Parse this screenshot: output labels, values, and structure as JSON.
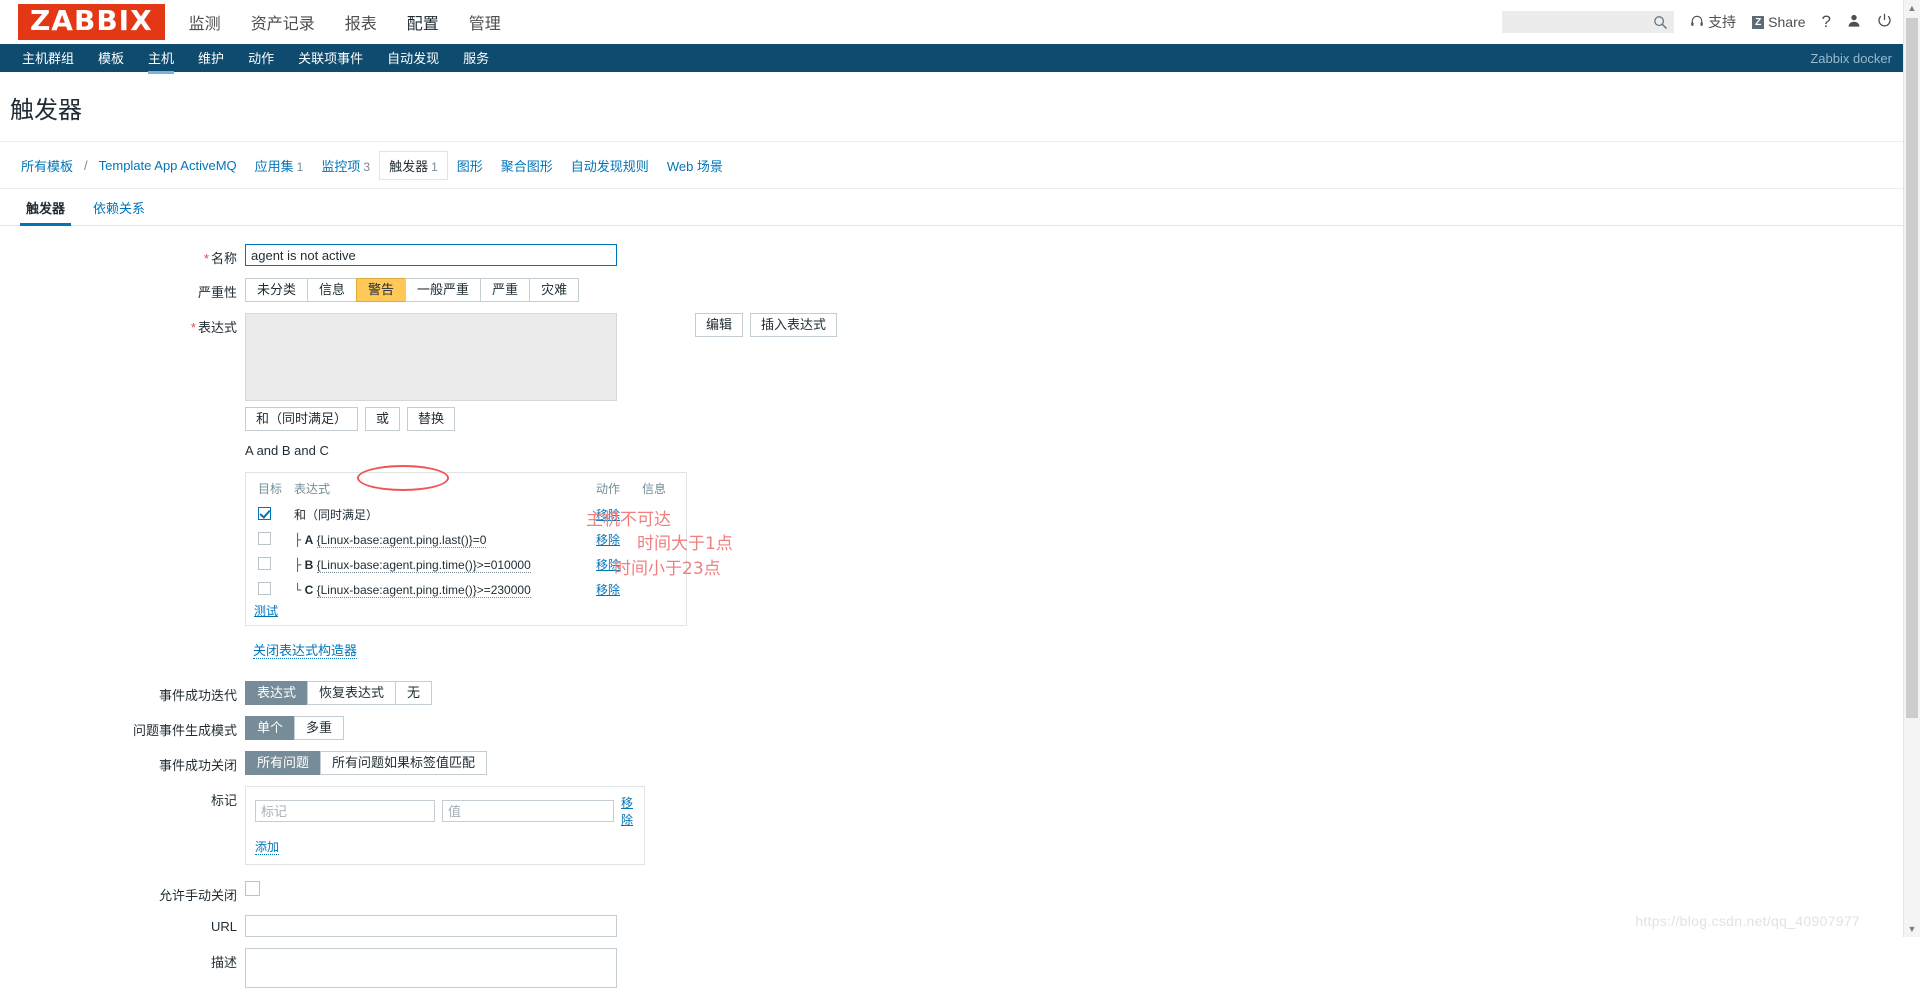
{
  "header": {
    "logo": "ZABBIX",
    "nav": [
      {
        "label": "监测",
        "active": false
      },
      {
        "label": "资产记录",
        "active": false
      },
      {
        "label": "报表",
        "active": false
      },
      {
        "label": "配置",
        "active": true
      },
      {
        "label": "管理",
        "active": false
      }
    ],
    "search_placeholder": "",
    "search_value": "",
    "support_label": "支持",
    "share_label": "Share",
    "share_badge": "Z",
    "help_label": "?",
    "icons": {
      "search": "search-icon",
      "support": "headset-icon",
      "share": "share-icon",
      "help": "question-mark-icon",
      "user": "user-icon",
      "power": "power-icon"
    }
  },
  "subnav": {
    "items": [
      {
        "label": "主机群组",
        "active": false
      },
      {
        "label": "模板",
        "active": false
      },
      {
        "label": "主机",
        "active": true
      },
      {
        "label": "维护",
        "active": false
      },
      {
        "label": "动作",
        "active": false
      },
      {
        "label": "关联项事件",
        "active": false
      },
      {
        "label": "自动发现",
        "active": false
      },
      {
        "label": "服务",
        "active": false
      }
    ],
    "server_name": "Zabbix docker"
  },
  "page": {
    "title": "触发器"
  },
  "breadcrumb": {
    "all_templates": "所有模板",
    "separator": "/",
    "template_name": "Template App ActiveMQ",
    "items": [
      {
        "label": "应用集",
        "count": "1",
        "active": false
      },
      {
        "label": "监控项",
        "count": "3",
        "active": false
      },
      {
        "label": "触发器",
        "count": "1",
        "active": true
      },
      {
        "label": "图形",
        "count": "",
        "active": false
      },
      {
        "label": "聚合图形",
        "count": "",
        "active": false
      },
      {
        "label": "自动发现规则",
        "count": "",
        "active": false
      },
      {
        "label": "Web 场景",
        "count": "",
        "active": false
      }
    ]
  },
  "form_tabs": [
    {
      "label": "触发器",
      "active": true
    },
    {
      "label": "依赖关系",
      "active": false
    }
  ],
  "form": {
    "name_label": "名称",
    "name_value": "agent is not active",
    "severity_label": "严重性",
    "severity_options": [
      {
        "label": "未分类",
        "selected": false
      },
      {
        "label": "信息",
        "selected": false
      },
      {
        "label": "警告",
        "selected": true
      },
      {
        "label": "一般严重",
        "selected": false
      },
      {
        "label": "严重",
        "selected": false
      },
      {
        "label": "灾难",
        "selected": false
      }
    ],
    "expression_label": "表达式",
    "expression_value": "",
    "edit_button": "编辑",
    "insert_expression_button": "插入表达式",
    "op_and": "和（同时满足）",
    "op_or": "或",
    "op_replace": "替换",
    "expression_preview": "A and B and C",
    "close_constructor_link": "关闭表达式构造器",
    "event_success_label": "事件成功迭代",
    "event_success_options": [
      {
        "label": "表达式",
        "selected": true
      },
      {
        "label": "恢复表达式",
        "selected": false
      },
      {
        "label": "无",
        "selected": false
      }
    ],
    "problem_event_label": "问题事件生成模式",
    "problem_event_options": [
      {
        "label": "单个",
        "selected": true
      },
      {
        "label": "多重",
        "selected": false
      }
    ],
    "event_close_label": "事件成功关闭",
    "event_close_options": [
      {
        "label": "所有问题",
        "selected": true
      },
      {
        "label": "所有问题如果标签值匹配",
        "selected": false
      }
    ],
    "tags_label": "标记",
    "tag_name_placeholder": "标记",
    "tag_name_value": "",
    "tag_value_placeholder": "值",
    "tag_value_value": "",
    "tag_remove": "移除",
    "tag_add": "添加",
    "manual_close_label": "允许手动关闭",
    "manual_close_checked": false,
    "url_label": "URL",
    "url_value": "",
    "description_label": "描述",
    "description_value": ""
  },
  "expression_table": {
    "headers": {
      "target": "目标",
      "expression": "表达式",
      "action": "动作",
      "info": "信息"
    },
    "rows": [
      {
        "checked": true,
        "tree": "",
        "letter": "",
        "expression": "和（同时满足）",
        "action": "移除",
        "annotation": "",
        "highlight": true
      },
      {
        "checked": false,
        "tree": "├",
        "letter": "A",
        "expression": "{Linux-base:agent.ping.last()}=0",
        "action": "移除",
        "annotation": "主机不可达",
        "highlight": false
      },
      {
        "checked": false,
        "tree": "├",
        "letter": "B",
        "expression": "{Linux-base:agent.ping.time()}>=010000",
        "action": "移除",
        "annotation": "时间大于1点",
        "highlight": false
      },
      {
        "checked": false,
        "tree": "└",
        "letter": "C",
        "expression": "{Linux-base:agent.ping.time()}>=230000",
        "action": "移除",
        "annotation": "时间小于23点",
        "highlight": false
      }
    ],
    "test_link": "测试"
  },
  "watermark": "https://blog.csdn.net/qq_40907977",
  "colors": {
    "brand_red": "#e33715",
    "nav_dark_blue": "#0e4b6e",
    "link_blue": "#0275b8",
    "warning_orange": "#ffc859",
    "selected_grey": "#768d99",
    "annotation_red": "#f08080"
  }
}
